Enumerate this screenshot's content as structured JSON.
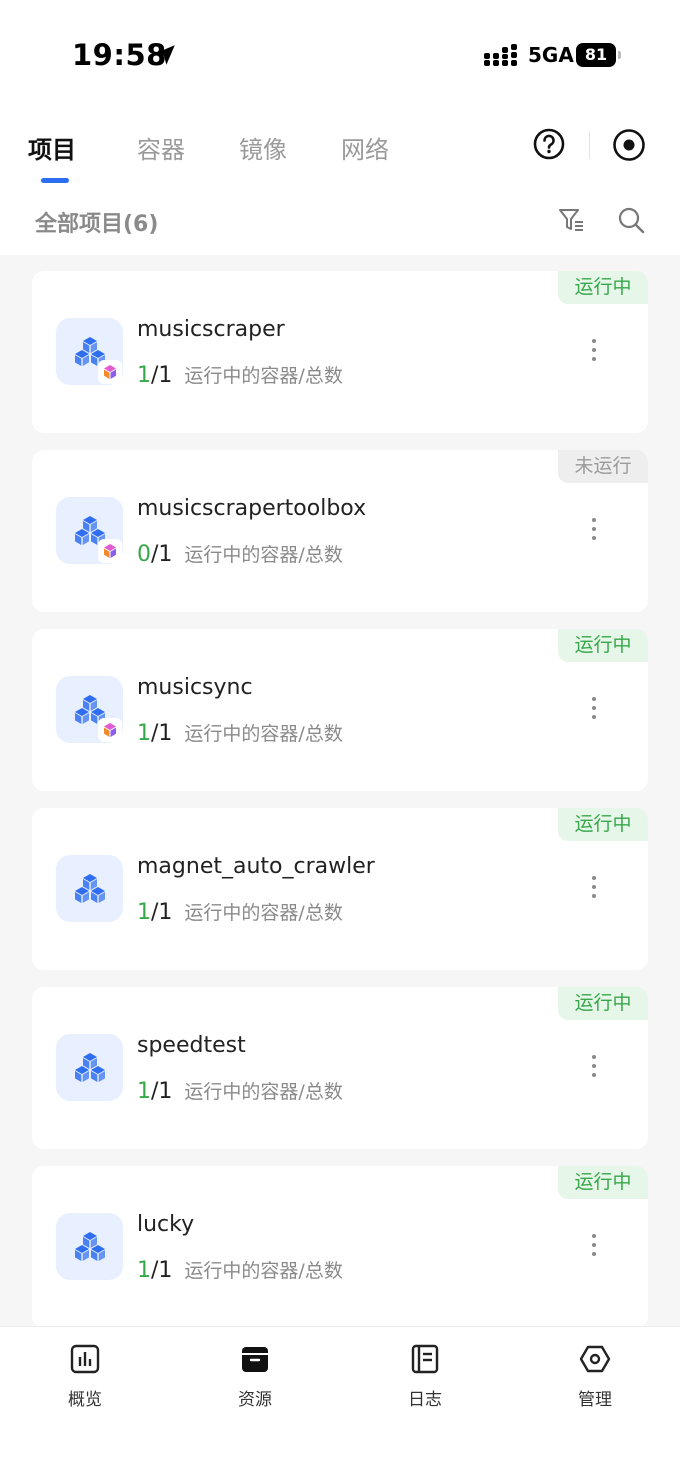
{
  "status_bar": {
    "time": "19:58",
    "network": "5GA",
    "battery": "81"
  },
  "tabs": [
    {
      "label": "项目",
      "active": true
    },
    {
      "label": "容器",
      "active": false
    },
    {
      "label": "镜像",
      "active": false
    },
    {
      "label": "网络",
      "active": false
    }
  ],
  "summary": "全部项目(6)",
  "projects": [
    {
      "name": "musicscraper",
      "status": "运行中",
      "running": "1",
      "total": "/1",
      "desc": "运行中的容器/总数"
    },
    {
      "name": "musicscrapertoolbox",
      "status": "未运行",
      "running": "0",
      "total": "/1",
      "desc": "运行中的容器/总数"
    },
    {
      "name": "musicsync",
      "status": "运行中",
      "running": "1",
      "total": "/1",
      "desc": "运行中的容器/总数"
    },
    {
      "name": "magnet_auto_crawler",
      "status": "运行中",
      "running": "1",
      "total": "/1",
      "desc": "运行中的容器/总数"
    },
    {
      "name": "speedtest",
      "status": "运行中",
      "running": "1",
      "total": "/1",
      "desc": "运行中的容器/总数"
    },
    {
      "name": "lucky",
      "status": "运行中",
      "running": "1",
      "total": "/1",
      "desc": "运行中的容器/总数"
    }
  ],
  "bottom_nav": [
    {
      "label": "概览",
      "icon": "chart-icon"
    },
    {
      "label": "资源",
      "icon": "box-icon"
    },
    {
      "label": "日志",
      "icon": "notebook-icon"
    },
    {
      "label": "管理",
      "icon": "hexagon-settings-icon"
    }
  ],
  "colors": {
    "accent": "#2b6ef2",
    "running": "#37a84a",
    "icon_bg": "#e8efff"
  }
}
